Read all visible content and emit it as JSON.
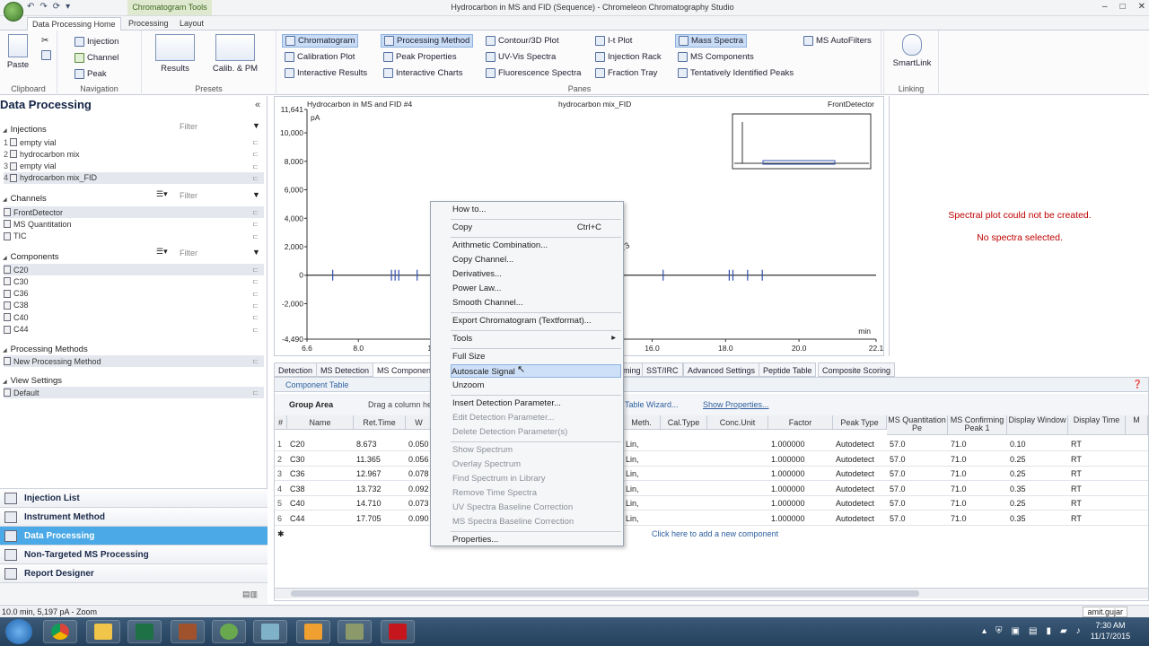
{
  "titlebar": {
    "tool_tab": "Chromatogram Tools",
    "window_title": "Hydrocarbon in MS and FID (Sequence) - Chromeleon Chromatography Studio"
  },
  "ribbon_tabs": [
    "Data Processing Home",
    "Processing",
    "Layout"
  ],
  "ribbon": {
    "clipboard": {
      "paste": "Paste",
      "label": "Clipboard"
    },
    "navigation": {
      "items": [
        "Injection",
        "Channel",
        "Peak"
      ],
      "label": "Navigation"
    },
    "presets": {
      "results": "Results",
      "calib": "Calib. & PM",
      "label": "Presets"
    },
    "panes": {
      "label": "Panes",
      "col1": [
        "Chromatogram",
        "Calibration Plot",
        "Interactive Results"
      ],
      "col2": [
        "Processing Method",
        "Peak Properties",
        "Interactive Charts"
      ],
      "col3": [
        "Contour/3D Plot",
        "UV-Vis Spectra",
        "Fluorescence Spectra"
      ],
      "col4": [
        "I-t Plot",
        "Injection Rack",
        "Fraction Tray"
      ],
      "col5": [
        "Mass Spectra",
        "MS Components",
        "Tentatively Identified Peaks"
      ],
      "col6": [
        "MS AutoFilters"
      ]
    },
    "linking": {
      "smartlink": "SmartLink",
      "label": "Linking"
    }
  },
  "left": {
    "title": "Data Processing",
    "filter_placeholder": "Filter",
    "injections_label": "Injections",
    "injections": [
      "empty vial",
      "hydrocarbon mix",
      "empty vial",
      "hydrocarbon mix_FID"
    ],
    "channels_label": "Channels",
    "channels": [
      "FrontDetector",
      "MS Quantitation",
      "TIC"
    ],
    "components_label": "Components",
    "components": [
      "C20",
      "C30",
      "C36",
      "C38",
      "C40",
      "C44"
    ],
    "methods_label": "Processing Methods",
    "methods": [
      "New Processing Method"
    ],
    "views_label": "View Settings",
    "views": [
      "Default"
    ]
  },
  "nav": [
    "Injection List",
    "Instrument Method",
    "Data Processing",
    "Non-Targeted MS Processing",
    "Report Designer"
  ],
  "chart": {
    "title_left": "Hydrocarbon in MS and FID #4",
    "title_center": "hydrocarbon mix_FID",
    "title_right": "FrontDetector",
    "unit_y": "pA",
    "unit_x": "min",
    "peak_label": "14.773",
    "chart_data": {
      "type": "line",
      "y_ticks": [
        "11,641",
        "10,000",
        "8,000",
        "6,000",
        "4,000",
        "2,000",
        "0",
        "-2,000",
        "-4,490"
      ],
      "x_ticks": [
        "6.6",
        "8.0",
        "10",
        "16.0",
        "18.0",
        "20.0",
        "22.1"
      ],
      "xlim": [
        6.6,
        22.1
      ],
      "ylim": [
        -4490,
        11641
      ],
      "peaks_x": [
        7.3,
        8.9,
        9.0,
        9.1,
        9.6,
        14.3,
        14.6,
        14.773,
        16.3,
        18.1,
        18.2,
        18.6,
        19.0
      ],
      "peak_label": "14.773"
    }
  },
  "right": {
    "msg1": "Spectral plot could not be created.",
    "msg2": "No spectra selected."
  },
  "bottom_tabs": [
    "Detection",
    "MS Detection",
    "MS Components",
    "ming",
    "SST/IRC",
    "Advanced Settings",
    "Peptide Table",
    "Composite Scoring"
  ],
  "table": {
    "title": "Component Table",
    "group_area": "Group Area",
    "drag_hint": "Drag a column he",
    "wizard": "Table Wizard...",
    "show_props": "Show Properties...",
    "headers": [
      "#",
      "Name",
      "Ret.Time",
      "W",
      "Meth.",
      "Cal.Type",
      "Conc.Unit",
      "Factor",
      "Peak Type",
      "MS Quantitation Pe",
      "MS Confirming Peak 1",
      "Display Window",
      "Display Time",
      "M"
    ],
    "rows": [
      [
        "1",
        "C20",
        "8.673",
        "0.050",
        "Lin,",
        "1.000000",
        "Autodetect",
        "57.0",
        "71.0",
        "0.10",
        "RT"
      ],
      [
        "2",
        "C30",
        "11.365",
        "0.056",
        "Lin,",
        "1.000000",
        "Autodetect",
        "57.0",
        "71.0",
        "0.25",
        "RT"
      ],
      [
        "3",
        "C36",
        "12.967",
        "0.078",
        "Lin,",
        "1.000000",
        "Autodetect",
        "57.0",
        "71.0",
        "0.25",
        "RT"
      ],
      [
        "4",
        "C38",
        "13.732",
        "0.092",
        "Lin,",
        "1.000000",
        "Autodetect",
        "57.0",
        "71.0",
        "0.35",
        "RT"
      ],
      [
        "5",
        "C40",
        "14.710",
        "0.073",
        "Lin,",
        "1.000000",
        "Autodetect",
        "57.0",
        "71.0",
        "0.25",
        "RT"
      ],
      [
        "6",
        "C44",
        "17.705",
        "0.090",
        "Lin,",
        "1.000000",
        "Autodetect",
        "57.0",
        "71.0",
        "0.35",
        "RT"
      ]
    ],
    "add_row": "Click here to add a new component"
  },
  "context_menu": {
    "items": [
      {
        "label": "How to...",
        "disabled": false
      },
      {
        "sep": true
      },
      {
        "label": "Copy",
        "shortcut": "Ctrl+C",
        "disabled": false
      },
      {
        "sep": true
      },
      {
        "label": "Arithmetic Combination...",
        "disabled": false
      },
      {
        "label": "Copy Channel...",
        "disabled": false
      },
      {
        "label": "Derivatives...",
        "disabled": false
      },
      {
        "label": "Power Law...",
        "disabled": false
      },
      {
        "label": "Smooth Channel...",
        "disabled": false
      },
      {
        "sep": true
      },
      {
        "label": "Export Chromatogram (Textformat)...",
        "disabled": false
      },
      {
        "sep": true
      },
      {
        "label": "Tools",
        "submenu": true,
        "disabled": false
      },
      {
        "sep": true
      },
      {
        "label": "Full Size",
        "disabled": false
      },
      {
        "label": "Autoscale Signal",
        "disabled": false,
        "highlight": true
      },
      {
        "label": "Unzoom",
        "disabled": false
      },
      {
        "sep": true
      },
      {
        "label": "Insert Detection Parameter...",
        "disabled": false
      },
      {
        "label": "Edit Detection Parameter...",
        "disabled": true
      },
      {
        "label": "Delete Detection Parameter(s)",
        "disabled": true
      },
      {
        "sep": true
      },
      {
        "label": "Show Spectrum",
        "disabled": true
      },
      {
        "label": "Overlay Spectrum",
        "disabled": true
      },
      {
        "label": "Find Spectrum in Library",
        "disabled": true
      },
      {
        "label": "Remove Time Spectra",
        "disabled": true
      },
      {
        "label": "UV Spectra Baseline Correction",
        "disabled": true
      },
      {
        "label": "MS Spectra Baseline Correction",
        "disabled": true
      },
      {
        "sep": true
      },
      {
        "label": "Properties...",
        "disabled": false
      }
    ]
  },
  "status": {
    "left": "10.0 min, 5,197 pA - Zoom",
    "user": "amit.gujar"
  },
  "taskbar": {
    "time": "7:30 AM",
    "date": "11/17/2015"
  }
}
